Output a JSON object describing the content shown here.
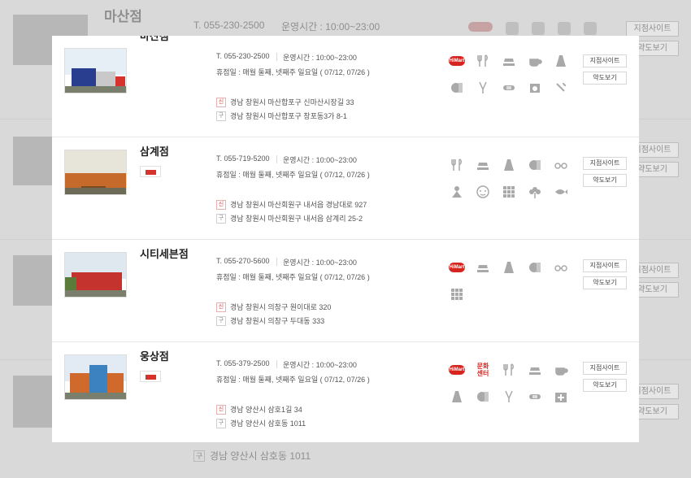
{
  "background": {
    "title": "마산점",
    "phone": "T. 055-230-2500",
    "hours": "운영시간 : 10:00~23:00",
    "button_site": "지점사이트",
    "button_map": "약도보기",
    "address_old_tag": "구",
    "address_old": "경남 양산시 삼호동 1011"
  },
  "branches": [
    {
      "name": "마산점",
      "phone": "T. 055-230-2500",
      "hours": "운영시간 : 10:00~23:00",
      "closed": "휴점일 : 매월 둘째, 넷째주 일요일 ( 07/12, 07/26 )",
      "address_new_tag": "신",
      "address_new": "경남 창원시 마산합포구 신마산시장길 33",
      "address_old_tag": "구",
      "address_old": "경남 창원시 마산합포구 창포동3가 8-1",
      "icons": [
        "hmart-badge",
        "restaurant-icon",
        "bakery-icon",
        "cafe-icon",
        "fashion-icon",
        "pharmacy-icon",
        "tailor-icon",
        "bandage-icon",
        "laundry-icon",
        "wrench-icon"
      ],
      "button_site": "지점사이트",
      "button_map": "약도보기",
      "delivery": false
    },
    {
      "name": "삼계점",
      "phone": "T. 055-719-5200",
      "hours": "운영시간 : 10:00~23:00",
      "closed": "휴점일 : 매월 둘째, 넷째주 일요일 ( 07/12, 07/26 )",
      "address_new_tag": "신",
      "address_new": "경남 창원시 마산회원구 내서읍 경남대로 927",
      "address_old_tag": "구",
      "address_old": "경남 창원시 마산회원구 내서읍 삼계리 25-2",
      "icons": [
        "restaurant-icon",
        "bakery-icon",
        "fashion-icon",
        "pharmacy-icon",
        "glasses-icon",
        "kids-icon",
        "baby-icon",
        "grid-icon",
        "flower-icon",
        "fish-icon"
      ],
      "button_site": "지점사이트",
      "button_map": "약도보기",
      "delivery": true
    },
    {
      "name": "시티세븐점",
      "phone": "T. 055-270-5600",
      "hours": "운영시간 : 10:00~23:00",
      "closed": "휴점일 : 매월 둘째, 넷째주 일요일 ( 07/12, 07/26 )",
      "address_new_tag": "신",
      "address_new": "경남 창원시 의창구 원이대로 320",
      "address_old_tag": "구",
      "address_old": "경남 창원시 의창구 두대동 333",
      "icons": [
        "hmart-badge",
        "bakery-icon",
        "fashion-icon",
        "pharmacy-icon",
        "glasses-icon",
        "grid-icon"
      ],
      "button_site": "지점사이트",
      "button_map": "약도보기",
      "delivery": false
    },
    {
      "name": "웅상점",
      "phone": "T. 055-379-2500",
      "hours": "운영시간 : 10:00~23:00",
      "closed": "휴점일 : 매월 둘째, 넷째주 일요일 ( 07/12, 07/26 )",
      "address_new_tag": "신",
      "address_new": "경남 양산시 삼호1길 34",
      "address_old_tag": "구",
      "address_old": "경남 양산시 삼호동 1011",
      "icons": [
        "hmart-badge",
        "culture-center-badge",
        "restaurant-icon",
        "bakery-icon",
        "cafe-icon",
        "fashion-icon",
        "pharmacy-icon",
        "tailor-icon",
        "bandage-icon",
        "hospital-icon"
      ],
      "button_site": "지점사이트",
      "button_map": "약도보기",
      "delivery": true
    }
  ],
  "badges": {
    "hmart": "HiMart",
    "culture_center": "문화센터"
  },
  "colors": {
    "accent_red": "#d6251f",
    "icon_gray": "#a9a9a9"
  }
}
